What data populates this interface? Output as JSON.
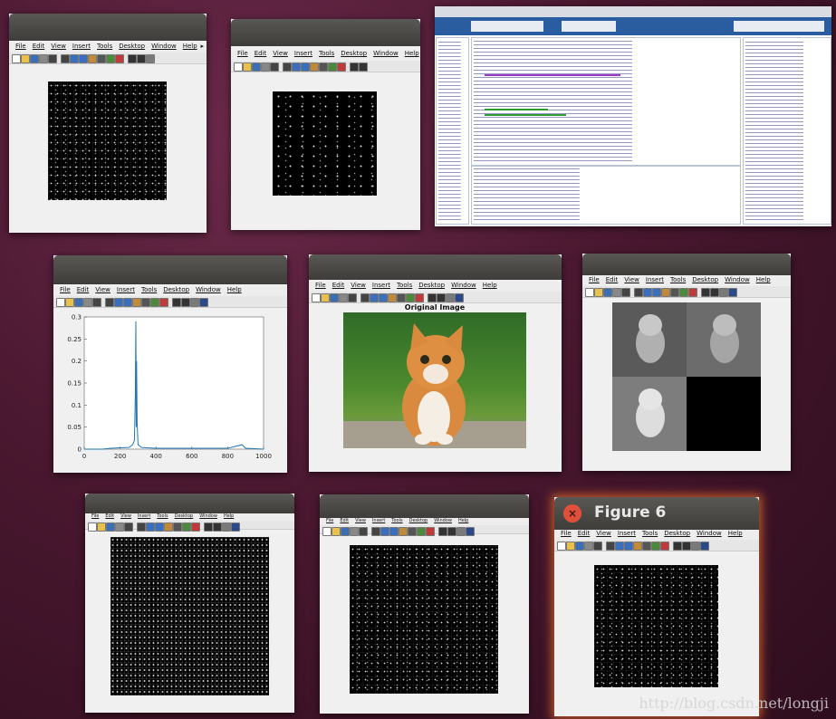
{
  "menu_items": [
    "File",
    "Edit",
    "View",
    "Insert",
    "Tools",
    "Desktop",
    "Window",
    "Help"
  ],
  "figure6": {
    "title": "Figure 6",
    "close_icon": "×"
  },
  "histogram": {
    "chart_data": {
      "type": "line",
      "title": "",
      "xlabel": "",
      "ylabel": "",
      "xlim": [
        0,
        1000
      ],
      "ylim": [
        0,
        0.3
      ],
      "x_ticks": [
        "0",
        "200",
        "400",
        "600",
        "800",
        "1000"
      ],
      "y_ticks": [
        "0",
        "0.05",
        "0.1",
        "0.15",
        "0.2",
        "0.25",
        "0.3"
      ],
      "series": [
        {
          "color": "#1f77b4",
          "x": [
            0,
            100,
            150,
            200,
            250,
            270,
            280,
            285,
            288,
            290,
            292,
            295,
            300,
            320,
            350,
            400,
            500,
            600,
            700,
            800,
            880,
            900,
            1000
          ],
          "y": [
            0,
            0,
            0.002,
            0.003,
            0.004,
            0.01,
            0.02,
            0.12,
            0.29,
            0.05,
            0.2,
            0.06,
            0.01,
            0.004,
            0.003,
            0.002,
            0.002,
            0.002,
            0.002,
            0.002,
            0.01,
            0.002,
            0
          ]
        }
      ]
    }
  },
  "original_image": {
    "title": "Original Image"
  },
  "watermark": "http://blog.csdn.net/longji"
}
